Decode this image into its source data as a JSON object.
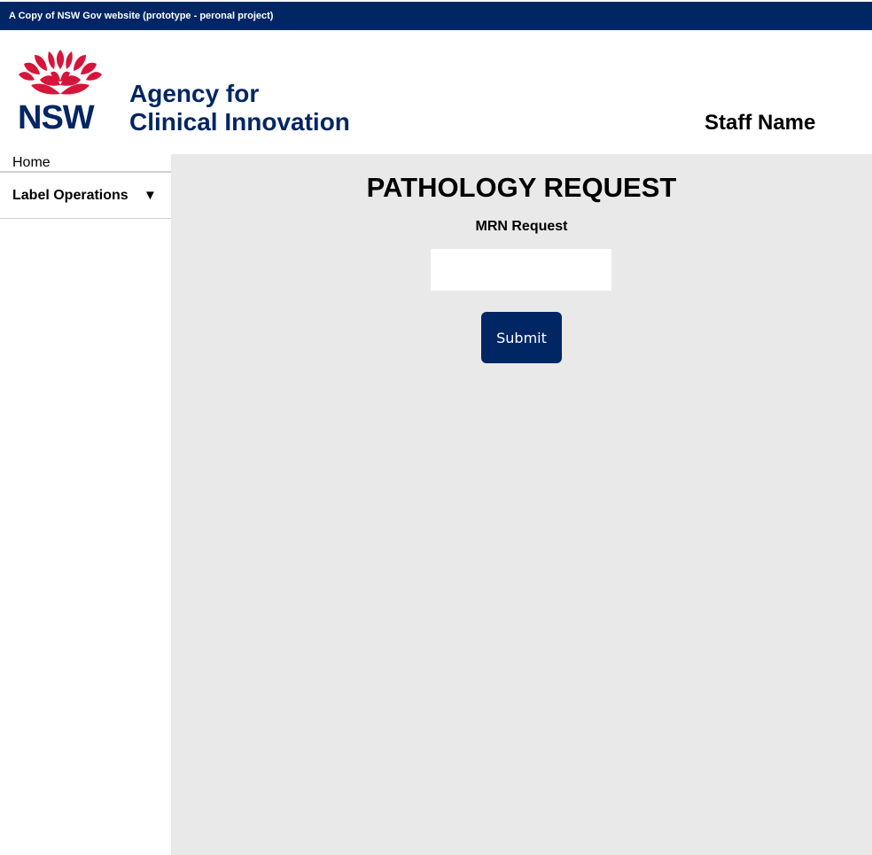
{
  "topbar": {
    "text": "A Copy of NSW Gov website (prototype - peronal project)"
  },
  "header": {
    "logo_text": "NSW",
    "agency_line1": "Agency for",
    "agency_line2": "Clinical Innovation",
    "staff_name": "Staff Name"
  },
  "sidebar": {
    "home_label": "Home",
    "label_operations": "Label Operations",
    "dropdown_arrow": "▼"
  },
  "main": {
    "title": "PATHOLOGY REQUEST",
    "mrn_label": "MRN Request",
    "mrn_value": "",
    "submit_label": "Submit"
  },
  "colors": {
    "brand_navy": "#002664",
    "waratah_red": "#d7153a",
    "content_bg": "#e9e9e9"
  },
  "icons": {
    "logo": "waratah-logo-icon",
    "dropdown": "triangle-down-icon"
  }
}
